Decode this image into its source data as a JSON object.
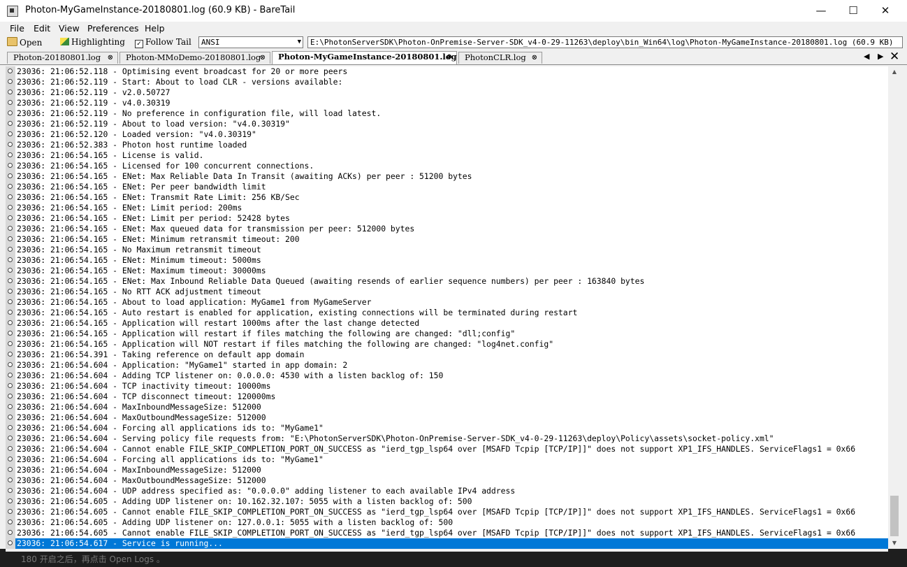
{
  "window": {
    "title": "Photon-MyGameInstance-20180801.log (60.9 KB) - BareTail",
    "minimize": "—",
    "maximize": "☐",
    "close": "✕"
  },
  "menu": [
    "File",
    "Edit",
    "View",
    "Preferences",
    "Help"
  ],
  "toolbar": {
    "open_label": "Open",
    "highlighting_label": "Highlighting",
    "follow_tail_label": "Follow Tail",
    "follow_tail_checked": true,
    "encoding_value": "ANSI",
    "path_value": "E:\\PhotonServerSDK\\Photon-OnPremise-Server-SDK_v4-0-29-11263\\deploy\\bin_Win64\\log\\Photon-MyGameInstance-20180801.log (60.9 KB)"
  },
  "tabs": [
    {
      "label": "Photon-20180801.log",
      "active": false
    },
    {
      "label": "Photon-MMoDemo-20180801.log",
      "active": false
    },
    {
      "label": "Photon-MyGameInstance-20180801.log",
      "active": true
    },
    {
      "label": "PhotonCLR.log",
      "active": false
    }
  ],
  "tab_nav": {
    "left": "◀",
    "right": "▶",
    "close": "✕"
  },
  "log_lines": [
    "23036: 21:06:52.118 - Optimising event broadcast for 20 or more peers",
    "23036: 21:06:52.119 - Start: About to load CLR - versions available:",
    "23036: 21:06:52.119 - v2.0.50727",
    "23036: 21:06:52.119 - v4.0.30319",
    "23036: 21:06:52.119 - No preference in configuration file, will load latest.",
    "23036: 21:06:52.119 - About to load version: \"v4.0.30319\"",
    "23036: 21:06:52.120 - Loaded version: \"v4.0.30319\"",
    "23036: 21:06:52.383 - Photon host runtime loaded",
    "23036: 21:06:54.165 - License is valid.",
    "23036: 21:06:54.165 - Licensed for 100 concurrent connections.",
    "23036: 21:06:54.165 - ENet: Max Reliable Data In Transit (awaiting ACKs) per peer : 51200 bytes",
    "23036: 21:06:54.165 - ENet: Per peer bandwidth limit",
    "23036: 21:06:54.165 - ENet: Transmit Rate Limit: 256 KB/Sec",
    "23036: 21:06:54.165 - ENet: Limit period: 200ms",
    "23036: 21:06:54.165 - ENet: Limit per period: 52428 bytes",
    "23036: 21:06:54.165 - ENet: Max queued data for transmission per peer: 512000 bytes",
    "23036: 21:06:54.165 - ENet: Minimum retransmit timeout: 200",
    "23036: 21:06:54.165 - No Maximum retransmit timeout",
    "23036: 21:06:54.165 - ENet: Minimum timeout: 5000ms",
    "23036: 21:06:54.165 - ENet: Maximum timeout: 30000ms",
    "23036: 21:06:54.165 - ENet: Max Inbound Reliable Data Queued (awaiting resends of earlier sequence numbers) per peer : 163840 bytes",
    "23036: 21:06:54.165 - No RTT ACK adjustment timeout",
    "23036: 21:06:54.165 - About to load application: MyGame1 from MyGameServer",
    "23036: 21:06:54.165 - Auto restart is enabled for application, existing connections will be terminated during restart",
    "23036: 21:06:54.165 - Application will restart 1000ms after the last change detected",
    "23036: 21:06:54.165 - Application will restart if files matching the following are changed: \"dll;config\"",
    "23036: 21:06:54.165 - Application will NOT restart if files matching the following are changed: \"log4net.config\"",
    "23036: 21:06:54.391 - Taking reference on default app domain",
    "23036: 21:06:54.604 - Application: \"MyGame1\" started in app domain: 2",
    "23036: 21:06:54.604 - Adding TCP listener on: 0.0.0.0: 4530 with a listen backlog of: 150",
    "23036: 21:06:54.604 - TCP inactivity timeout: 10000ms",
    "23036: 21:06:54.604 - TCP disconnect timeout: 120000ms",
    "23036: 21:06:54.604 - MaxInboundMessageSize: 512000",
    "23036: 21:06:54.604 - MaxOutboundMessageSize: 512000",
    "23036: 21:06:54.604 - Forcing all applications ids to: \"MyGame1\"",
    "23036: 21:06:54.604 - Serving policy file requests from: \"E:\\PhotonServerSDK\\Photon-OnPremise-Server-SDK_v4-0-29-11263\\deploy\\Policy\\assets\\socket-policy.xml\"",
    "23036: 21:06:54.604 - Cannot enable FILE_SKIP_COMPLETION_PORT_ON_SUCCESS as \"ierd_tgp_lsp64 over [MSAFD Tcpip [TCP/IP]]\" does not support XP1_IFS_HANDLES. ServiceFlags1 = 0x66",
    "23036: 21:06:54.604 - Forcing all applications ids to: \"MyGame1\"",
    "23036: 21:06:54.604 - MaxInboundMessageSize: 512000",
    "23036: 21:06:54.604 - MaxOutboundMessageSize: 512000",
    "23036: 21:06:54.604 - UDP address specified as: \"0.0.0.0\" adding listener to each available IPv4 address",
    "23036: 21:06:54.605 - Adding UDP listener on: 10.162.32.107: 5055 with a listen backlog of: 500",
    "23036: 21:06:54.605 - Cannot enable FILE_SKIP_COMPLETION_PORT_ON_SUCCESS as \"ierd_tgp_lsp64 over [MSAFD Tcpip [TCP/IP]]\" does not support XP1_IFS_HANDLES. ServiceFlags1 = 0x66",
    "23036: 21:06:54.605 - Adding UDP listener on: 127.0.0.1: 5055 with a listen backlog of: 500",
    "23036: 21:06:54.605 - Cannot enable FILE_SKIP_COMPLETION_PORT_ON_SUCCESS as \"ierd_tgp_lsp64 over [MSAFD Tcpip [TCP/IP]]\" does not support XP1_IFS_HANDLES. ServiceFlags1 = 0x66",
    "23036: 21:06:54.617 - Service is running..."
  ],
  "selected_line_index": 45,
  "colors": {
    "selection": "#0078d7"
  },
  "scroll": {
    "up": "▲",
    "down": "▼"
  },
  "background_text": "180    开启之后，再点击 Open Logs 。"
}
